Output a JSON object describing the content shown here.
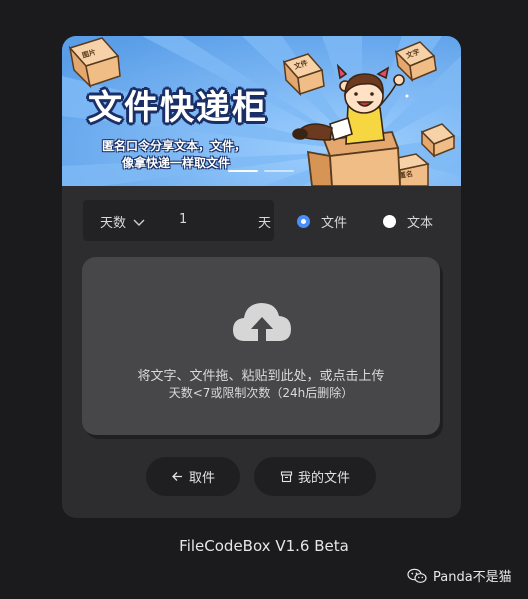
{
  "banner": {
    "title": "文件快递柜",
    "subtitle_line1": "匿名口令分享文本，文件，",
    "subtitle_line2": "像拿快递一样取文件",
    "box_labels": [
      "图片",
      "文件",
      "文字",
      "匿名"
    ]
  },
  "options": {
    "days_select_label": "天数",
    "days_value": "1",
    "days_unit": "天",
    "type_options": [
      {
        "label": "文件",
        "selected": true
      },
      {
        "label": "文本",
        "selected": false
      }
    ]
  },
  "upload": {
    "icon": "cloud-upload-icon",
    "hint": "将文字、文件拖、粘贴到此处，或点击上传",
    "limit": "天数<7或限制次数（24h后删除）"
  },
  "buttons": {
    "fetch_label": "取件",
    "myfiles_label": "我的文件"
  },
  "footer": {
    "version": "FileCodeBox V1.6 Beta"
  },
  "watermark": {
    "text": "Panda不是猫"
  },
  "colors": {
    "page_bg": "#1b1b1d",
    "card_bg": "#2d2d2f",
    "banner_bg": "#63a7ee",
    "accent": "#4a8ff5",
    "upload_bg": "#474648"
  }
}
